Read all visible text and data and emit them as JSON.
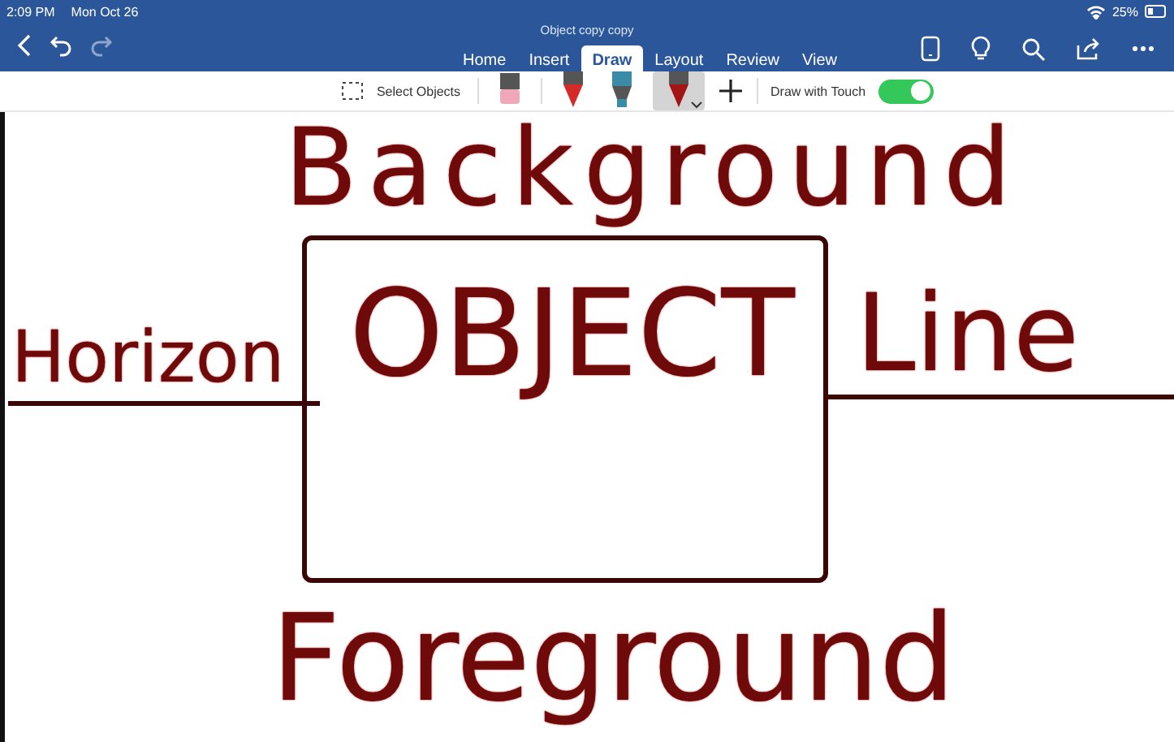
{
  "status_bar": {
    "time": "2:09 PM",
    "date": "Mon Oct 26",
    "battery": "25%"
  },
  "window": {
    "title": "Object copy copy"
  },
  "tabs": [
    {
      "label": "Home",
      "selected": false
    },
    {
      "label": "Insert",
      "selected": false
    },
    {
      "label": "Draw",
      "selected": true
    },
    {
      "label": "Layout",
      "selected": false
    },
    {
      "label": "Review",
      "selected": false
    },
    {
      "label": "View",
      "selected": false
    }
  ],
  "toolbar": {
    "select_objects": "Select Objects",
    "tools": [
      {
        "kind": "eraser",
        "selected": false
      },
      {
        "kind": "pen",
        "color": "#d42a2a",
        "selected": false
      },
      {
        "kind": "highlighter",
        "color": "#3b8ba6",
        "selected": false
      },
      {
        "kind": "pen",
        "color": "#a31515",
        "selected": true
      }
    ],
    "draw_with_touch": {
      "label": "Draw with Touch",
      "on": true
    }
  },
  "canvas": {
    "ink": [
      "Background",
      "Horizon",
      "OBJECT",
      "Line",
      "Foreground"
    ]
  }
}
